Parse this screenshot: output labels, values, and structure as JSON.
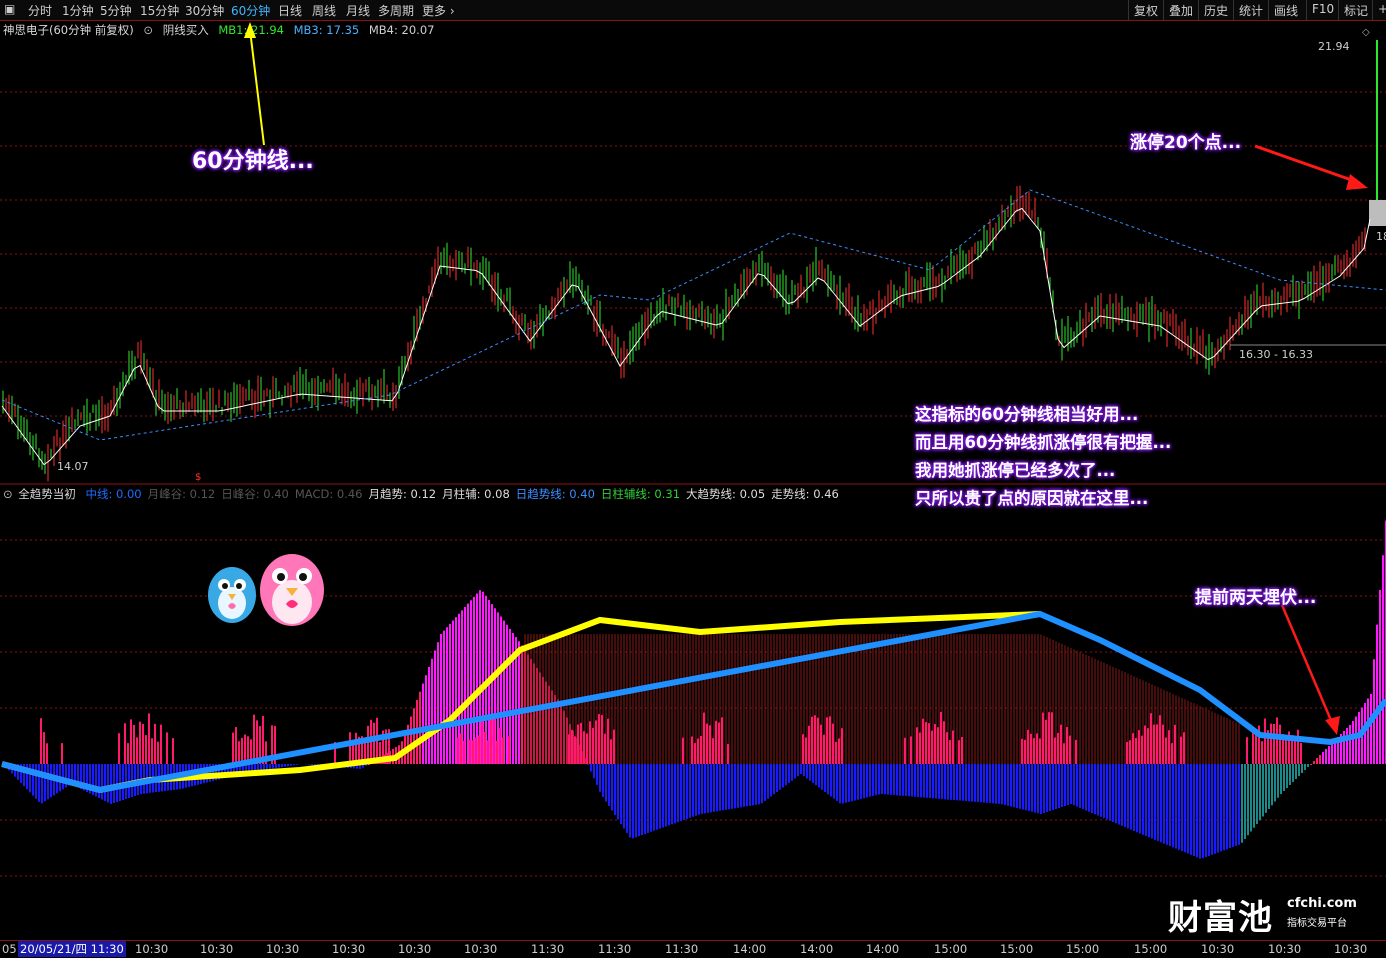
{
  "toolbar": {
    "icon": "panel-icon",
    "periods": [
      "分时",
      "1分钟",
      "5分钟",
      "15分钟",
      "30分钟",
      "60分钟",
      "日线",
      "周线",
      "月线",
      "多周期",
      "更多"
    ],
    "active_period": "60分钟",
    "right_items": [
      "复权",
      "叠加",
      "历史",
      "统计",
      "画线",
      "F10",
      "标记",
      "+"
    ]
  },
  "main_chart": {
    "stock_title": "神思电子(60分钟 前复权)",
    "indicator_name": "阴线买入",
    "mb1_label": "MB1: 21.94",
    "mb3_label": "MB3: 17.35",
    "mb4_label": "MB4: 20.07",
    "high_price": "21.94",
    "low_price": "14.07",
    "range_label": "16.30 - 16.33",
    "right_cut_label": "18"
  },
  "sub_chart": {
    "indicator_name": "全趋势当初",
    "items": [
      {
        "label": "中线",
        "value": "0.00",
        "color": "#1e6bff"
      },
      {
        "label": "月峰谷",
        "value": "0.12",
        "color": "#555555"
      },
      {
        "label": "日峰谷",
        "value": "0.40",
        "color": "#555555"
      },
      {
        "label": "MACD",
        "value": "0.46",
        "color": "#555555"
      },
      {
        "label": "月趋势",
        "value": "0.12",
        "color": "#dddddd"
      },
      {
        "label": "月柱辅",
        "value": "0.08",
        "color": "#dddddd"
      },
      {
        "label": "日趋势线",
        "value": "0.40",
        "color": "#3c8cff"
      },
      {
        "label": "日柱辅线",
        "value": "0.31",
        "color": "#31d03a"
      },
      {
        "label": "大趋势线",
        "value": "0.05",
        "color": "#dddddd"
      },
      {
        "label": "走势线",
        "value": "0.46",
        "color": "#dddddd"
      }
    ]
  },
  "annotations": {
    "sixty_min": "60分钟线...",
    "limit_up": "涨停20个点...",
    "paragraph": [
      "这指标的60分钟线相当好用...",
      "而且用60分钟线抓涨停很有把握...",
      "我用她抓涨停已经多次了...",
      "只所以贵了点的原因就在这里..."
    ],
    "ambush": "提前两天埋伏..."
  },
  "watermark": {
    "logo_text": "财富池",
    "site": "cfchi.com",
    "tagline": "指标交易平台"
  },
  "x_axis": {
    "first_label": "05",
    "cursor_label": "20/05/21/四 11:30",
    "labels": [
      "10:30",
      "10:30",
      "10:30",
      "10:30",
      "10:30",
      "10:30",
      "11:30",
      "11:30",
      "11:30",
      "14:00",
      "14:00",
      "14:00",
      "15:00",
      "15:00",
      "15:00",
      "15:00",
      "10:30",
      "10:30",
      "10:30"
    ]
  },
  "colors": {
    "background": "#000000",
    "grid": "#8b1010",
    "positive_bar": "#ff1a6e",
    "negative_bar": "#1a1aff",
    "teal_bar": "#1a8a8a",
    "magenta_bar": "#ff19ff",
    "trend_yellow": "#ffff00",
    "trend_blue": "#1e90ff",
    "annotation_glow": "#7a19d6"
  }
}
